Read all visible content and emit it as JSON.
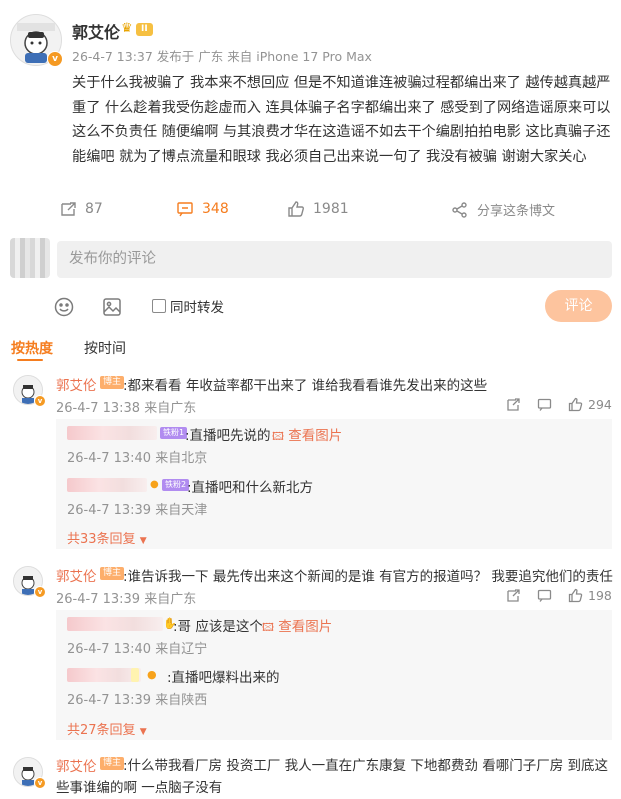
{
  "post": {
    "author": "郭艾伦",
    "level_badge": "II",
    "meta": "26-4-7 13:37  发布于 广东  来自 iPhone 17 Pro Max",
    "text": "关于什么我被骗了 我本来不想回应 但是不知道谁连被骗过程都编出来了 越传越真越严重了 什么趁着我受伤趁虚而入 连具体骗子名字都编出来了  感受到了网络造谣原来可以这么不负责任 随便编啊  与其浪费才华在这造谣不如去干个编剧拍拍电影  这比真骗子还能编吧 就为了博点流量和眼球 我必须自己出来说一句了 我没有被骗 谢谢大家关心",
    "reposts": "87",
    "comments": "348",
    "likes": "1981",
    "share_label": "分享这条博文"
  },
  "composer": {
    "placeholder": "发布你的评论",
    "repost_label": "同时转发",
    "submit_label": "评论"
  },
  "sort": {
    "hot": "按热度",
    "time": "按时间"
  },
  "comments": [
    {
      "name": "郭艾伦",
      "tag": "博主",
      "text": ":都来看看 年收益率都干出来了 谁给我看看谁先发出来的这些",
      "meta": "26-4-7 13:38  来自广东",
      "likes": "294",
      "replies": [
        {
          "fan_tag": "铁粉1",
          "text": ":直播吧先说的",
          "pic": "查看图片",
          "meta": "26-4-7 13:40  来自北京"
        },
        {
          "fan_tag": "铁粉2",
          "text": ":直播吧和什么新北方",
          "pic": "",
          "meta": "26-4-7 13:39  来自天津"
        }
      ],
      "more": "共33条回复"
    },
    {
      "name": "郭艾伦",
      "tag": "博主",
      "text": ":谁告诉我一下 最先传出来这个新闻的是谁 有官方的报道吗？ 我要追究他们的责任",
      "meta": "26-4-7 13:39  来自广东",
      "likes": "198",
      "replies": [
        {
          "fan_tag": "",
          "text": ":哥 应该是这个",
          "pic": "查看图片",
          "meta": "26-4-7 13:40  来自辽宁"
        },
        {
          "fan_tag": "",
          "text": ":直播吧爆料出来的",
          "pic": "",
          "meta": "26-4-7 13:39  来自陕西"
        }
      ],
      "more": "共27条回复"
    },
    {
      "name": "郭艾伦",
      "tag": "博主",
      "text": ":什么带我看厂房 投资工厂 我人一直在广东康复 下地都费劲 看哪门子厂房 到底这些事谁编的啊 一点脑子没有"
    }
  ]
}
